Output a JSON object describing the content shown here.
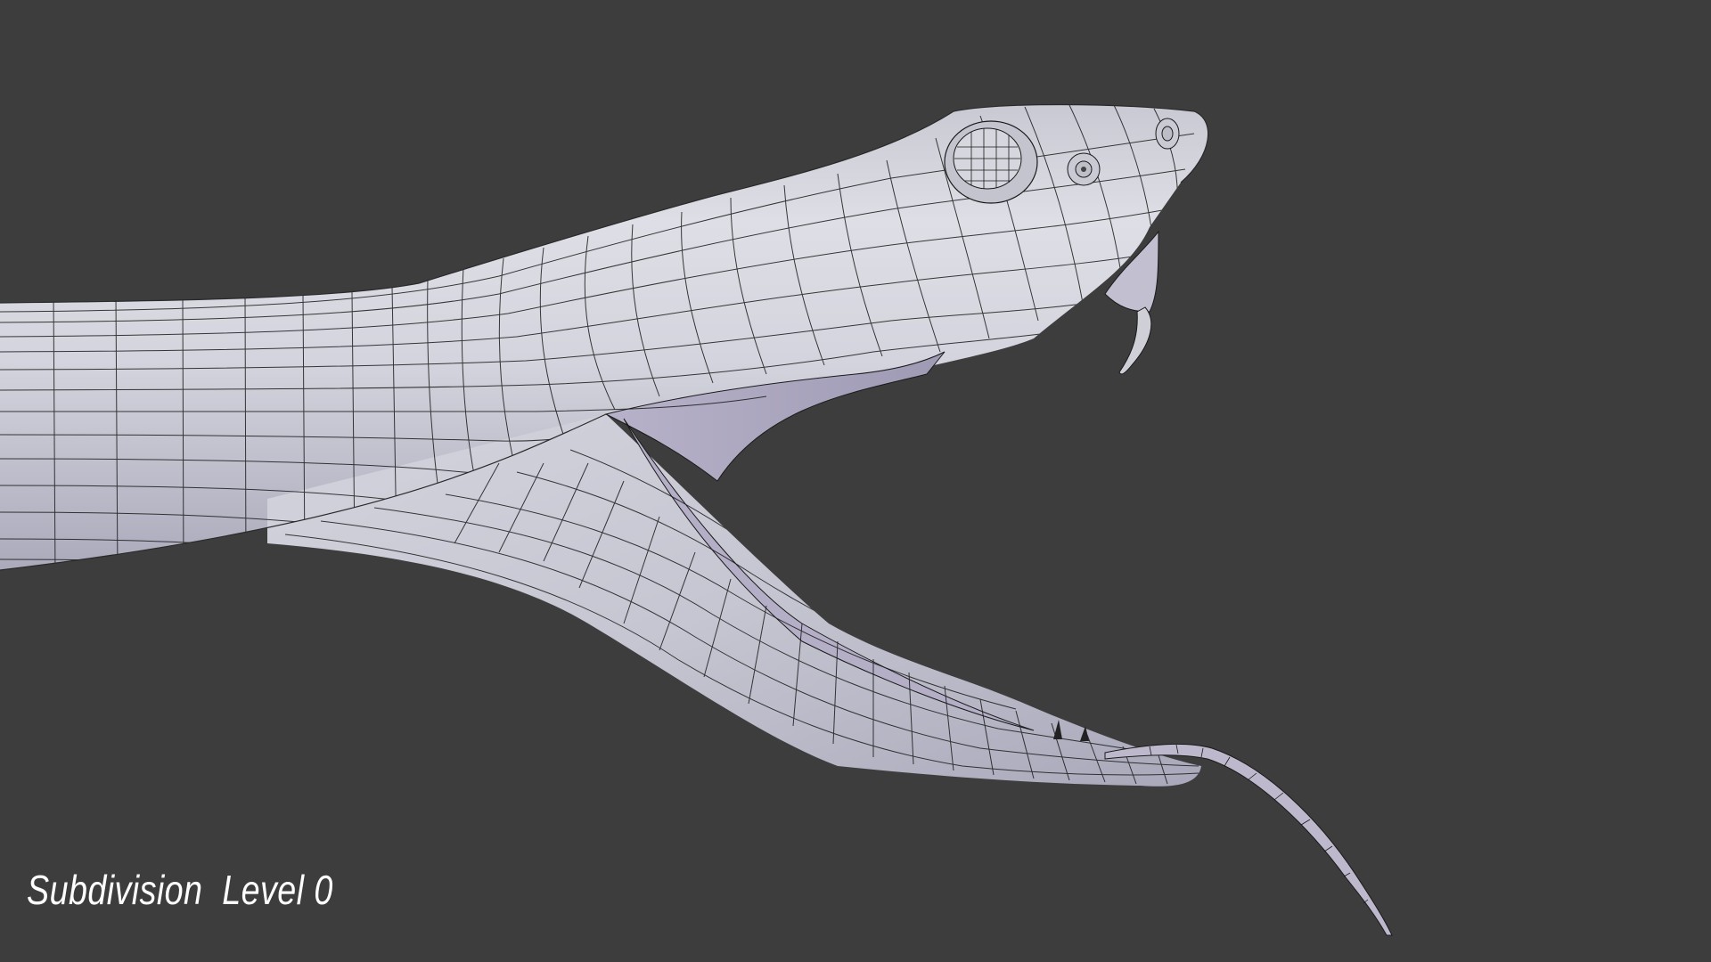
{
  "viewport": {
    "background_color": "#3d3d3d",
    "mesh_color": "#d2d2dc",
    "wire_color": "#1a1a1a",
    "mouth_color": "#b8b4c8"
  },
  "overlay": {
    "label": "Subdivision  Level 0"
  }
}
